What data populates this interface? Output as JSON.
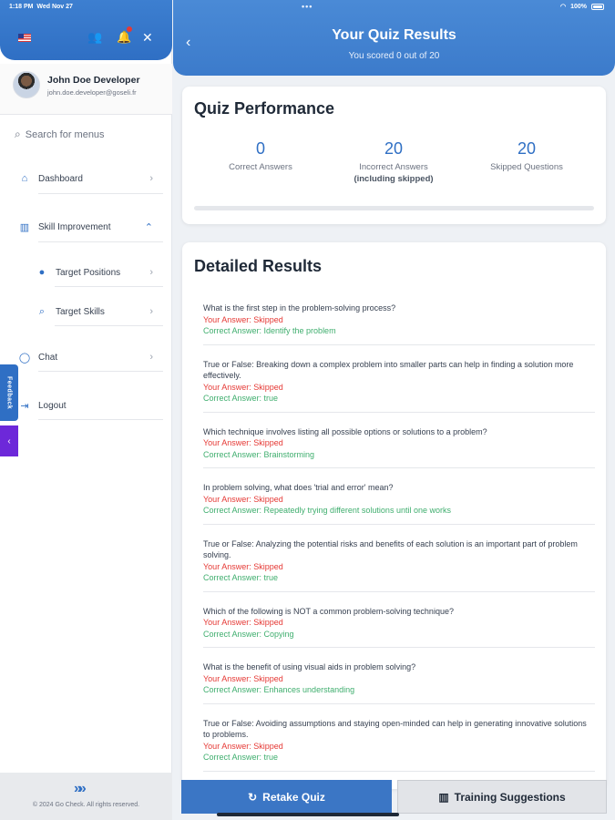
{
  "status_bar": {
    "time": "1:18 PM",
    "date": "Wed Nov 27",
    "battery": "100%"
  },
  "sidebar": {
    "user_name": "John Doe Developer",
    "user_email": "john.doe.developer@goseli.fr",
    "search_placeholder": "Search for menus",
    "items": [
      {
        "label": "Dashboard",
        "icon": "home-icon"
      },
      {
        "label": "Skill Improvement",
        "icon": "book-icon"
      },
      {
        "label": "Target Positions",
        "icon": "check-circle-icon"
      },
      {
        "label": "Target Skills",
        "icon": "search-icon"
      },
      {
        "label": "Chat",
        "icon": "chat-icon"
      },
      {
        "label": "Logout",
        "icon": "logout-icon"
      }
    ],
    "feedback_label": "Feedback",
    "copyright": "© 2024 Go Check. All rights reserved."
  },
  "header": {
    "title": "Your Quiz Results",
    "subtitle": "You scored 0 out of 20"
  },
  "performance": {
    "title": "Quiz Performance",
    "correct": {
      "value": "0",
      "label": "Correct Answers"
    },
    "incorrect": {
      "value": "20",
      "label": "Incorrect Answers",
      "sublabel": "(including skipped)"
    },
    "skipped": {
      "value": "20",
      "label": "Skipped Questions"
    },
    "progress_fraction": 0
  },
  "details": {
    "title": "Detailed Results",
    "questions": [
      {
        "q": "What is the first step in the problem-solving process?",
        "your": "Your Answer: Skipped",
        "correct": "Correct Answer: Identify the problem"
      },
      {
        "q": "True or False: Breaking down a complex problem into smaller parts can help in finding a solution more effectively.",
        "your": "Your Answer: Skipped",
        "correct": "Correct Answer: true"
      },
      {
        "q": "Which technique involves listing all possible options or solutions to a problem?",
        "your": "Your Answer: Skipped",
        "correct": "Correct Answer: Brainstorming"
      },
      {
        "q": "In problem solving, what does 'trial and error' mean?",
        "your": "Your Answer: Skipped",
        "correct": "Correct Answer: Repeatedly trying different solutions until one works"
      },
      {
        "q": "True or False: Analyzing the potential risks and benefits of each solution is an important part of problem solving.",
        "your": "Your Answer: Skipped",
        "correct": "Correct Answer: true"
      },
      {
        "q": "Which of the following is NOT a common problem-solving technique?",
        "your": "Your Answer: Skipped",
        "correct": "Correct Answer: Copying"
      },
      {
        "q": "What is the benefit of using visual aids in problem solving?",
        "your": "Your Answer: Skipped",
        "correct": "Correct Answer: Enhances understanding"
      },
      {
        "q": "True or False: Avoiding assumptions and staying open-minded can help in generating innovative solutions to problems.",
        "your": "Your Answer: Skipped",
        "correct": "Correct Answer: true"
      }
    ]
  },
  "buttons": {
    "retake": "Retake Quiz",
    "training": "Training Suggestions"
  }
}
